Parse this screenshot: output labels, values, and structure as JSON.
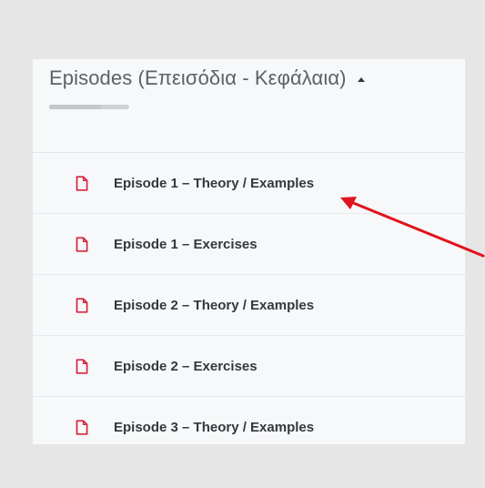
{
  "section": {
    "title": "Episodes (Επεισόδια - Κεφάλαια)",
    "caret_icon": "caret-up-icon",
    "progress": 0.65
  },
  "episodes": [
    {
      "label": "Episode 1 – Theory / Examples",
      "icon": "file-icon"
    },
    {
      "label": "Episode 1 – Exercises",
      "icon": "file-icon"
    },
    {
      "label": "Episode 2 – Theory / Examples",
      "icon": "file-icon"
    },
    {
      "label": "Episode 2 – Exercises",
      "icon": "file-icon"
    },
    {
      "label": "Episode 3 – Theory / Examples",
      "icon": "file-icon"
    }
  ],
  "colors": {
    "background": "#e6e6e6",
    "panel": "#f7f8fa",
    "icon": "#d6253d",
    "annotation_arrow": "#e0141b"
  },
  "annotation": {
    "icon": "arrow-icon"
  }
}
